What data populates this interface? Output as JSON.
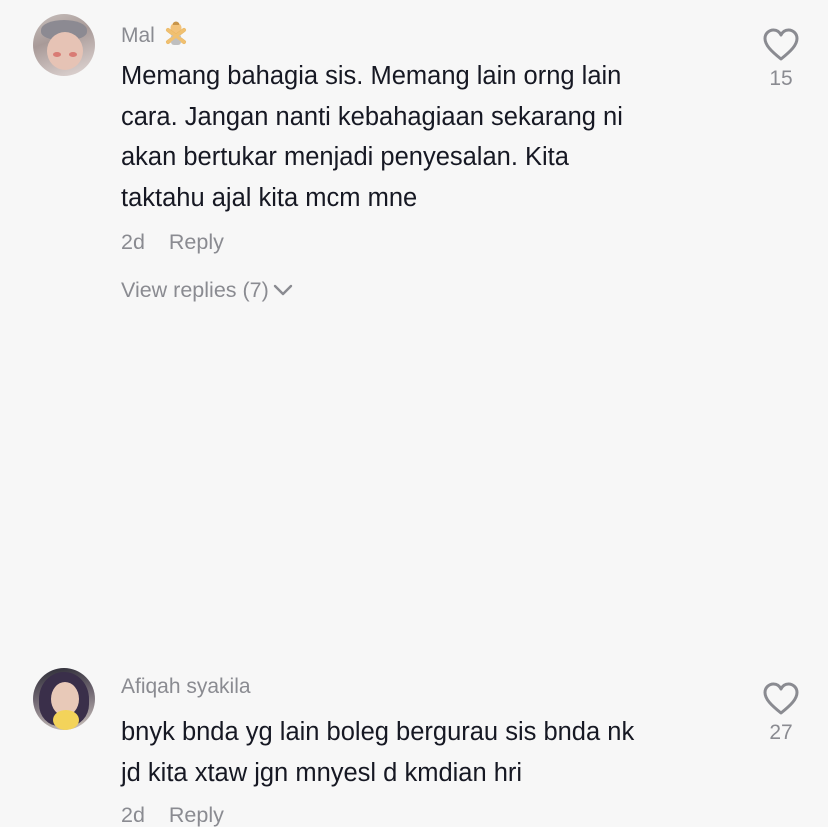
{
  "comments": [
    {
      "username": "Mal",
      "username_emoji": "person-gesturing-no-emoji",
      "text": "Memang bahagia sis. Memang lain orng lain\ncara. Jangan nanti kebahagiaan sekarang ni\nakan bertukar menjadi penyesalan. Kita\ntaktahu ajal kita mcm mne",
      "age": "2d",
      "reply_label": "Reply",
      "view_replies": "View replies (7)",
      "likes": "15"
    },
    {
      "username": "Afiqah syakila",
      "text": "bnyk bnda yg lain boleg bergurau sis bnda nk\njd kita xtaw jgn mnyesl d kmdian hri",
      "age": "2d",
      "reply_label": "Reply",
      "likes": "27"
    }
  ],
  "icons": {
    "like": "heart-outline-icon",
    "expand": "chevron-down-icon"
  },
  "colors": {
    "background": "#f7f7f7",
    "text": "#161823",
    "muted": "#8a8b91"
  }
}
